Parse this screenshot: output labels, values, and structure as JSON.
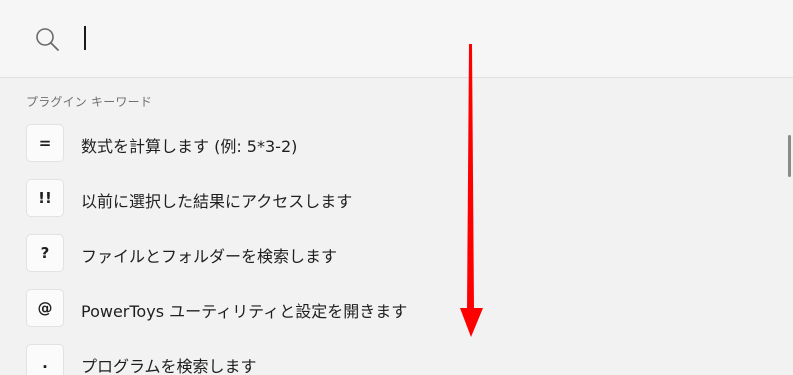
{
  "search": {
    "icon": "search-icon",
    "value": "",
    "placeholder": ""
  },
  "section": {
    "header": "プラグイン キーワード"
  },
  "items": [
    {
      "keyword": "=",
      "label": "数式を計算します (例: 5*3-2)"
    },
    {
      "keyword": "!!",
      "label": "以前に選択した結果にアクセスします"
    },
    {
      "keyword": "?",
      "label": "ファイルとフォルダーを検索します"
    },
    {
      "keyword": "@",
      "label": "PowerToys ユーティリティと設定を開きます"
    },
    {
      "keyword": ".",
      "label": "プログラムを検索します"
    }
  ],
  "colors": {
    "arrow": "#ff0000",
    "background": "#f2f2f2"
  }
}
